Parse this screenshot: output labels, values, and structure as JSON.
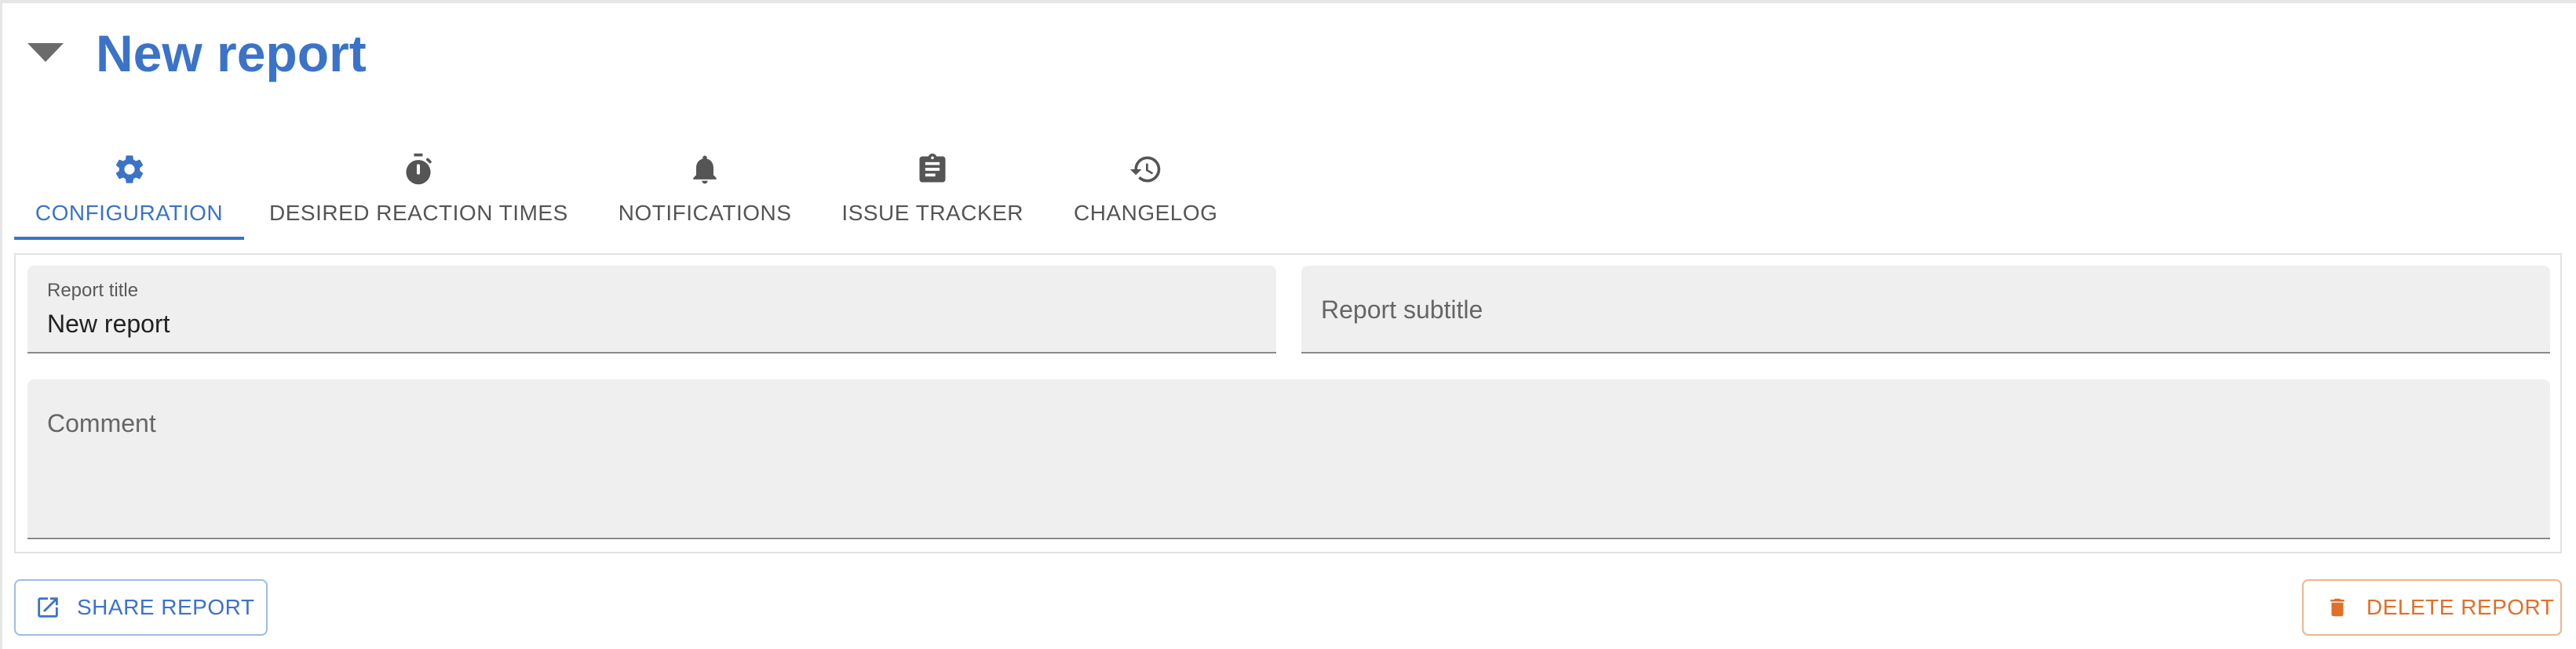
{
  "header": {
    "title": "New report"
  },
  "tabs": [
    {
      "label": "CONFIGURATION",
      "icon": "gear-icon",
      "active": true
    },
    {
      "label": "DESIRED REACTION TIMES",
      "icon": "stopwatch-icon",
      "active": false
    },
    {
      "label": "NOTIFICATIONS",
      "icon": "bell-icon",
      "active": false
    },
    {
      "label": "ISSUE TRACKER",
      "icon": "clipboard-icon",
      "active": false
    },
    {
      "label": "CHANGELOG",
      "icon": "history-icon",
      "active": false
    }
  ],
  "form": {
    "report_title": {
      "label": "Report title",
      "value": "New report"
    },
    "report_subtitle": {
      "placeholder": "Report subtitle"
    },
    "comment": {
      "placeholder": "Comment"
    }
  },
  "actions": {
    "share_label": "SHARE REPORT",
    "delete_label": "DELETE REPORT"
  },
  "colors": {
    "accent": "#3b73c9",
    "danger": "#e07028",
    "field_bg": "#efefef"
  }
}
